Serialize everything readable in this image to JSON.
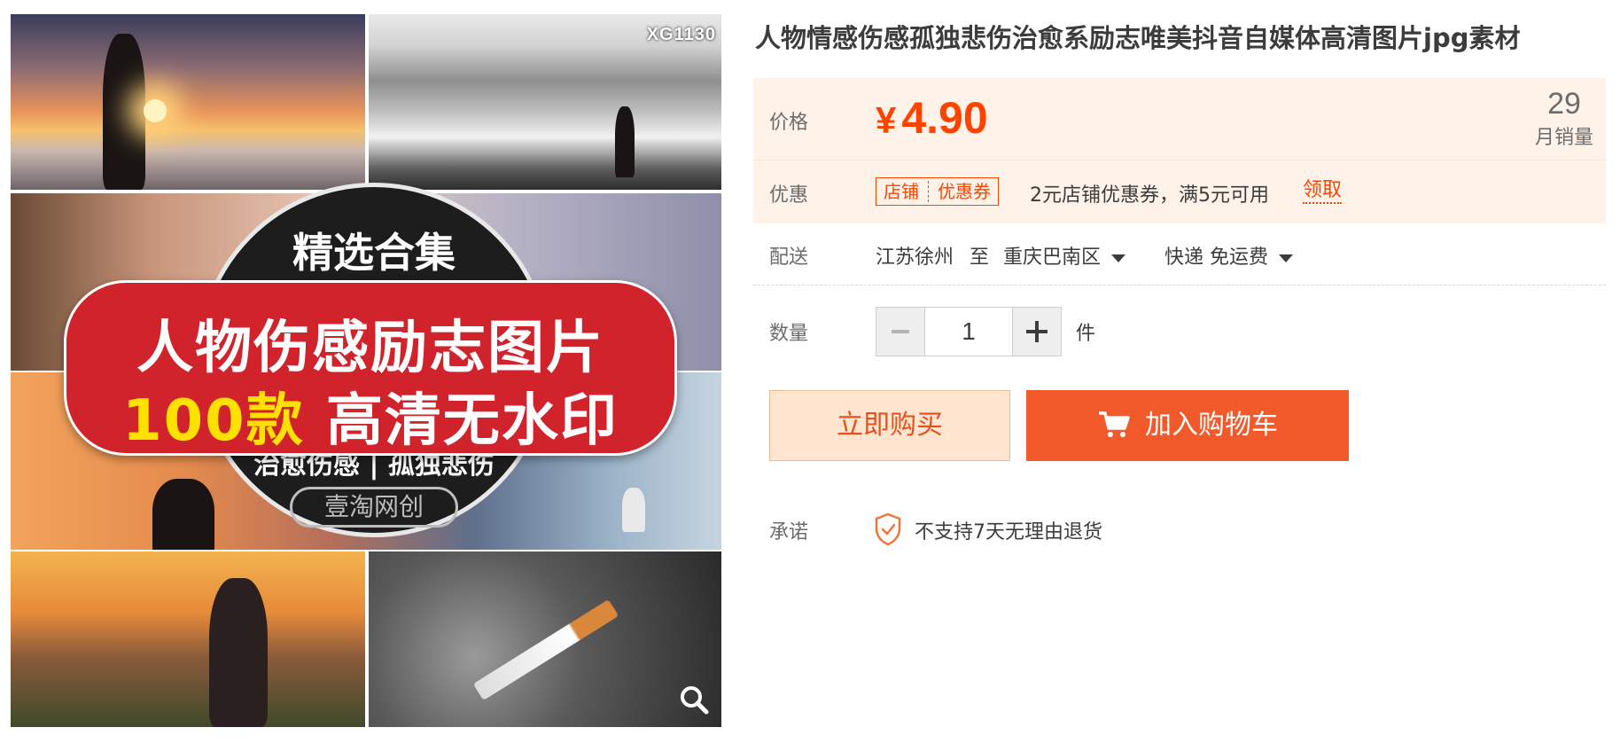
{
  "product": {
    "title": "人物情感伤感孤独悲伤治愈系励志唯美抖音自媒体高清图片jpg素材",
    "image": {
      "watermark": "XG1130",
      "circle_top": "精选合集",
      "banner_line1": "人物伤感励志图片",
      "banner_count": "100款",
      "banner_line2_rest": " 高清无水印",
      "circle_sub": "治愈伤感 | 孤独悲伤",
      "brand": "壹淘网创"
    }
  },
  "price": {
    "label": "价格",
    "currency": "¥",
    "value": "4.90",
    "monthly_sales": "29",
    "monthly_sales_label": "月销量"
  },
  "coupon": {
    "label": "优惠",
    "tag_left": "店铺",
    "tag_right": "优惠券",
    "desc": "2元店铺优惠券，满5元可用",
    "action": "领取"
  },
  "shipping": {
    "label": "配送",
    "from": "江苏徐州",
    "to_word": "至",
    "destination": "重庆巴南区",
    "method": "快递",
    "fee": "免运费"
  },
  "quantity": {
    "label": "数量",
    "value": "1",
    "unit": "件"
  },
  "actions": {
    "buy_now": "立即购买",
    "add_to_cart": "加入购物车"
  },
  "promise": {
    "label": "承诺",
    "text": "不支持7天无理由退货"
  },
  "colors": {
    "accent": "#ff4400",
    "cart_button": "#f25a2c",
    "price_panel": "#fff2e8"
  },
  "icons": [
    "search-icon",
    "cart-icon",
    "shield-check-icon",
    "caret-down-icon"
  ]
}
